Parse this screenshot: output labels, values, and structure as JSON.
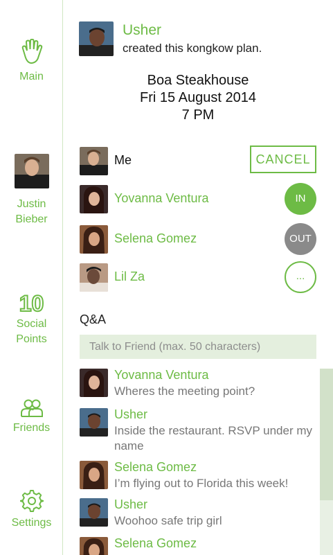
{
  "sidebar": {
    "main_label": "Main",
    "profile_name_line1": "Justin",
    "profile_name_line2": "Bieber",
    "points_value": "10",
    "points_label_line1": "Social",
    "points_label_line2": "Points",
    "friends_label": "Friends",
    "settings_label": "Settings"
  },
  "plan": {
    "creator_name": "Usher",
    "creator_text": "created this kongkow plan.",
    "venue": "Boa Steakhouse",
    "date": "Fri 15 August 2014",
    "time": "7 PM"
  },
  "participants": [
    {
      "name": "Me",
      "action": "CANCEL"
    },
    {
      "name": "Yovanna Ventura",
      "status": "IN"
    },
    {
      "name": "Selena Gomez",
      "status": "OUT"
    },
    {
      "name": "Lil Za",
      "status": "..."
    }
  ],
  "qa": {
    "title": "Q&A",
    "placeholder": "Talk to Friend (max. 50 characters)"
  },
  "messages": [
    {
      "name": "Yovanna Ventura",
      "text": "Wheres the meeting point?"
    },
    {
      "name": "Usher",
      "text": "Inside the restaurant. RSVP under my name"
    },
    {
      "name": "Selena Gomez",
      "text": "I’m flying out to Florida this week!"
    },
    {
      "name": "Usher",
      "text": "Woohoo safe trip girl"
    },
    {
      "name": "Selena Gomez",
      "text": ""
    }
  ],
  "colors": {
    "accent": "#6dbb45",
    "out_status": "#8a8a8a",
    "input_bg": "#e4efde"
  }
}
